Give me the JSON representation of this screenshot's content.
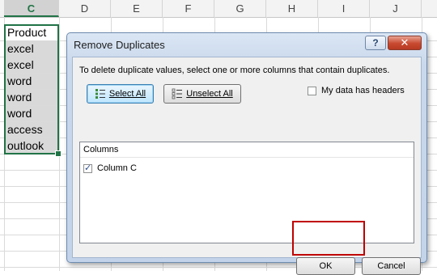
{
  "spreadsheet": {
    "columns": [
      "C",
      "D",
      "E",
      "F",
      "G",
      "H",
      "I",
      "J"
    ],
    "selected_column": "C",
    "cells_c": [
      "Product",
      "excel",
      "excel",
      "word",
      "word",
      "word",
      "access",
      "outlook"
    ]
  },
  "dialog": {
    "title": "Remove Duplicates",
    "help_label": "?",
    "close_label": "✕",
    "instructions": "To delete duplicate values, select one or more columns that contain duplicates.",
    "select_all_label": "Select All",
    "unselect_all_label": "Unselect All",
    "headers_label": "My data has headers",
    "headers_checked": false,
    "columns_header": "Columns",
    "column_items": [
      {
        "label": "Column C",
        "checked": true
      }
    ],
    "ok_label": "OK",
    "cancel_label": "Cancel"
  },
  "colors": {
    "accent_green": "#217346",
    "highlight_red": "#c00000",
    "dialog_frame": "#c3d3e9"
  }
}
